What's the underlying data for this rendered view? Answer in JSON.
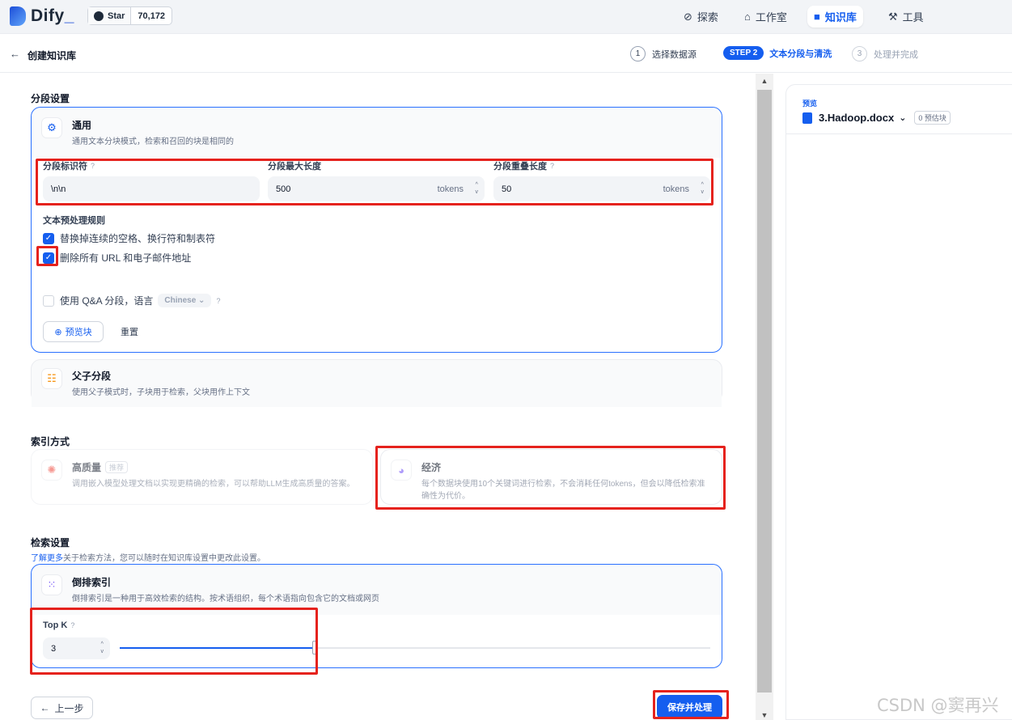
{
  "nav": {
    "logo": "Dify",
    "logo_cursor": "_",
    "github_label": "Star",
    "github_count": "70,172",
    "tabs": [
      {
        "label": "探索",
        "icon": "explore-icon"
      },
      {
        "label": "工作室",
        "icon": "studio-icon"
      },
      {
        "label": "知识库",
        "icon": "knowledge-icon"
      },
      {
        "label": "工具",
        "icon": "tools-icon"
      }
    ],
    "active_tab": "知识库"
  },
  "header": {
    "back": "←",
    "title": "创建知识库",
    "steps": [
      {
        "num": "1",
        "label": "选择数据源"
      },
      {
        "num": "STEP 2",
        "label": "文本分段与清洗"
      },
      {
        "num": "3",
        "label": "处理并完成"
      }
    ]
  },
  "segment": {
    "section_title": "分段设置",
    "general": {
      "title": "通用",
      "desc": "通用文本分块模式，检索和召回的块是相同的"
    },
    "fields": {
      "separator_label": "分段标识符",
      "separator_value": "\\n\\n",
      "max_len_label": "分段最大长度",
      "max_len_value": "500",
      "overlap_label": "分段重叠长度",
      "overlap_value": "50",
      "unit": "tokens",
      "help": "?"
    },
    "rules_title": "文本预处理规则",
    "rules": [
      {
        "label": "替换掉连续的空格、换行符和制表符",
        "checked": true
      },
      {
        "label": "删除所有 URL 和电子邮件地址",
        "checked": true
      }
    ],
    "qa": {
      "label": "使用 Q&A 分段，语言",
      "language": "Chinese",
      "checked": false
    },
    "preview_button": "预览块",
    "reset_button": "重置",
    "parent_child": {
      "title": "父子分段",
      "desc": "使用父子模式时，子块用于检索，父块用作上下文"
    }
  },
  "index": {
    "section_title": "索引方式",
    "high": {
      "title": "高质量",
      "tag": "推荐",
      "desc": "调用嵌入模型处理文档以实现更精确的检索，可以帮助LLM生成高质量的答案。"
    },
    "economy": {
      "title": "经济",
      "desc": "每个数据块使用10个关键词进行检索，不会消耗任何tokens，但会以降低检索准确性为代价。"
    }
  },
  "retrieval": {
    "section_title": "检索设置",
    "learn_more": "了解更多",
    "hint": "关于检索方法，您可以随时在知识库设置中更改此设置。",
    "inverted": {
      "title": "倒排索引",
      "desc": "倒排索引是一种用于高效检索的结构。按术语组织，每个术语指向包含它的文档或网页"
    },
    "topk_label": "Top K",
    "topk_value": "3",
    "topk_fraction": 0.33
  },
  "footer": {
    "prev": "上一步",
    "save": "保存并处理"
  },
  "preview": {
    "label": "预览",
    "file": "3.Hadoop.docx",
    "count": "0 预估块"
  },
  "watermark": "CSDN @窦再兴",
  "colors": {
    "accent": "#155eef",
    "highlight": "#e5221d"
  }
}
